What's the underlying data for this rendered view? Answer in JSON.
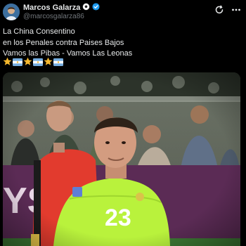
{
  "post": {
    "author_name": "Marcos Galarza",
    "handle": "@marcosgalarza86",
    "text_lines": [
      "La China Consentino",
      "en los Penales contra Paises Bajos",
      "Vamos las Pibas - Vamos Las Leonas"
    ],
    "emoji_sequence": [
      "star",
      "argentina-flag",
      "star",
      "argentina-flag",
      "star",
      "argentina-flag"
    ]
  },
  "media": {
    "jersey_number": "23",
    "banner_text": "YS"
  },
  "colors": {
    "background": "#000000",
    "text_primary": "#e7e9ea",
    "text_secondary": "#71767b",
    "verified": "#1d9bf0",
    "jersey_green": "#b9f23c",
    "referee_red": "#e23b2e",
    "flag_blue": "#74acdf",
    "star_gold": "#f5b82e"
  }
}
